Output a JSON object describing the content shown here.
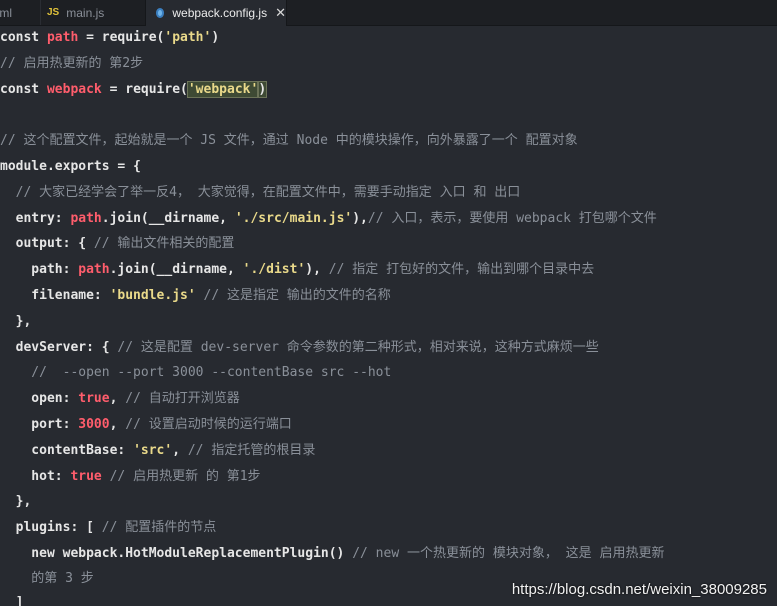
{
  "tabs": [
    {
      "label": "tml"
    },
    {
      "icon": "js-icon",
      "icon_text": "JS",
      "label": "main.js"
    },
    {
      "icon": "gear-icon",
      "label": "webpack.config.js",
      "close": "✕"
    }
  ],
  "code": {
    "l1": [
      "const",
      " ",
      "path",
      " = require(",
      "'path'",
      ")"
    ],
    "l2": [
      "// 启用热更新的 第2步"
    ],
    "l3": [
      "const",
      " ",
      "webpack",
      " = require(",
      "'webpack'",
      ")"
    ],
    "l4": [
      "// 这个配置文件，起始就是一个 JS 文件，通过 Node 中的模块操作，向外暴露了一个 配置对象"
    ],
    "l5": [
      "module.exports = {"
    ],
    "l6": [
      "  // 大家已经学会了举一反4， 大家觉得，在配置文件中，需要手动指定 入口 和 出口"
    ],
    "l7": [
      "  entry: ",
      "path",
      ".join(__dirname, ",
      "'./src/main.js'",
      "),",
      "// 入口，表示，要使用 webpack 打包哪个文件"
    ],
    "l8": [
      "  output: { ",
      "// 输出文件相关的配置"
    ],
    "l9": [
      "    path: ",
      "path",
      ".join(__dirname, ",
      "'./dist'",
      "), ",
      "// 指定 打包好的文件，输出到哪个目录中去"
    ],
    "l10": [
      "    filename: ",
      "'bundle.js'",
      " ",
      "// 这是指定 输出的文件的名称"
    ],
    "l11": [
      "  },"
    ],
    "l12": [
      "  devServer: { ",
      "// 这是配置 dev-server 命令参数的第二种形式，相对来说，这种方式麻烦一些"
    ],
    "l13": [
      "    //  --open --port 3000 --contentBase src --hot"
    ],
    "l14": [
      "    open: ",
      "true",
      ", ",
      "// 自动打开浏览器"
    ],
    "l15": [
      "    port: ",
      "3000",
      ", ",
      "// 设置启动时候的运行端口"
    ],
    "l16": [
      "    contentBase: ",
      "'src'",
      ", ",
      "// 指定托管的根目录"
    ],
    "l17": [
      "    hot: ",
      "true",
      " ",
      "// 启用热更新 的 第1步"
    ],
    "l18": [
      "  },"
    ],
    "l19": [
      "  plugins: [ ",
      "// 配置插件的节点"
    ],
    "l20": [
      "    new webpack.HotModuleReplacementPlugin() ",
      "// new 一个热更新的 模块对象， 这是 启用热更新"
    ],
    "l21": [
      "    的第 3 步"
    ],
    "l22": [
      "  ]"
    ]
  },
  "watermark": "https://blog.csdn.net/weixin_38009285"
}
